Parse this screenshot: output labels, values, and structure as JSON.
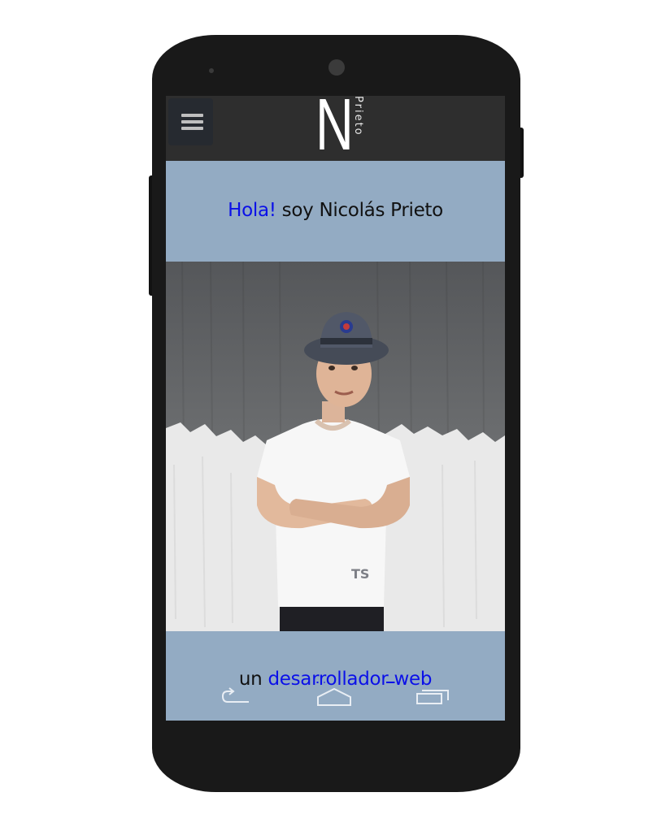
{
  "header": {
    "menu_icon": "hamburger-menu-icon",
    "logo_letter": "N",
    "logo_word": "Prieto"
  },
  "hero": {
    "greeting_accent": "Hola!",
    "greeting_rest": " soy Nicolás Prieto"
  },
  "photo": {
    "description_icon": "portrait-photo"
  },
  "footer_band": {
    "prefix": "un ",
    "accent": "desarrollador web"
  },
  "nav_bar": {
    "back_icon": "back-arrow-icon",
    "home_icon": "home-icon",
    "recents_icon": "recent-apps-icon"
  },
  "colors": {
    "accent": "#0b10e8",
    "band": "#93abc3",
    "topbar": "#2e2e2e",
    "phone": "#191919"
  }
}
